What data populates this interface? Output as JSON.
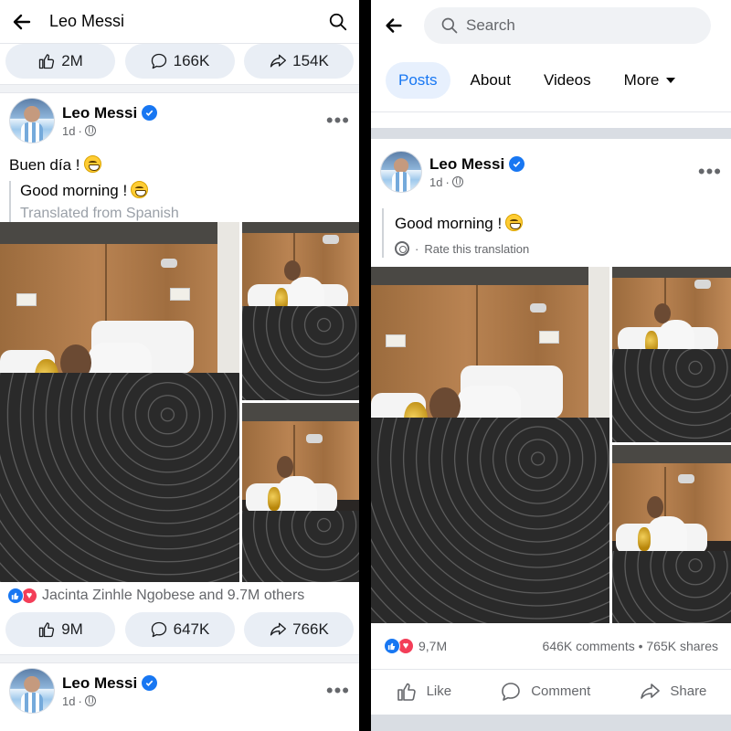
{
  "left": {
    "header": {
      "title": "Leo Messi"
    },
    "top_stats": {
      "likes": "2M",
      "comments": "166K",
      "shares": "154K"
    },
    "post": {
      "author": "Leo Messi",
      "time": "1d",
      "text": "Buen día !",
      "translation": "Good morning !",
      "translation_note": "Translated from Spanish",
      "reactions_text": "Jacinta Zinhle Ngobese and 9.7M others",
      "stats": {
        "likes": "9M",
        "comments": "647K",
        "shares": "766K"
      }
    },
    "next_post": {
      "author": "Leo Messi",
      "time": "1d"
    }
  },
  "right": {
    "search": {
      "placeholder": "Search"
    },
    "tabs": [
      {
        "label": "Posts",
        "active": true
      },
      {
        "label": "About"
      },
      {
        "label": "Videos"
      },
      {
        "label": "More"
      }
    ],
    "post": {
      "author": "Leo Messi",
      "time": "1d",
      "text": "Good morning !",
      "rate_translation": "Rate this translation",
      "reaction_count": "9,7M",
      "comments_shares": "646K comments • 765K shares",
      "actions": {
        "like": "Like",
        "comment": "Comment",
        "share": "Share"
      }
    }
  },
  "colors": {
    "accent": "#1877f2",
    "love": "#f33e58",
    "pill_bg": "#e9eef5"
  },
  "icons": [
    "back-arrow-icon",
    "search-icon",
    "like-icon",
    "comment-icon",
    "share-icon",
    "verified-icon",
    "globe-icon",
    "more-dots-icon",
    "gear-icon"
  ]
}
